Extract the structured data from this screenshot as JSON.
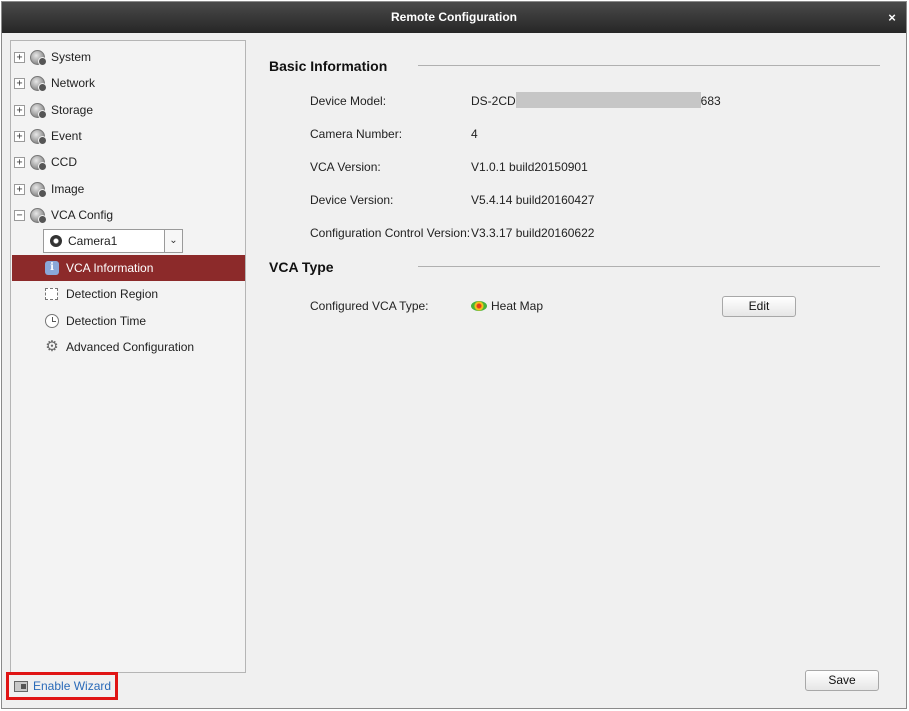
{
  "window": {
    "title": "Remote Configuration",
    "close_glyph": "×"
  },
  "sidebar": {
    "tree": [
      {
        "label": "System",
        "expander": "+"
      },
      {
        "label": "Network",
        "expander": "+"
      },
      {
        "label": "Storage",
        "expander": "+"
      },
      {
        "label": "Event",
        "expander": "+"
      },
      {
        "label": "CCD",
        "expander": "+"
      },
      {
        "label": "Image",
        "expander": "+"
      },
      {
        "label": "VCA Config",
        "expander": "−"
      }
    ],
    "camera_select": {
      "value": "Camera1",
      "chevron": "⌄"
    },
    "sub_items": [
      {
        "label": "VCA Information",
        "icon": "info-icon",
        "selected": true
      },
      {
        "label": "Detection Region",
        "icon": "region-icon",
        "selected": false
      },
      {
        "label": "Detection Time",
        "icon": "clock-icon",
        "selected": false
      },
      {
        "label": "Advanced Configuration",
        "icon": "gear-icon",
        "selected": false
      }
    ],
    "info_glyph": "i",
    "gear_glyph": "⚙"
  },
  "basic_info": {
    "title": "Basic Information",
    "fields": [
      {
        "label": "Device Model:",
        "value_prefix": "DS-2CD",
        "value_suffix": "683"
      },
      {
        "label": "Camera Number:",
        "value": "4"
      },
      {
        "label": "VCA Version:",
        "value": "V1.0.1 build20150901"
      },
      {
        "label": "Device Version:",
        "value": "V5.4.14 build20160427"
      },
      {
        "label": "Configuration Control Version:",
        "value": "V3.3.17 build20160622"
      }
    ]
  },
  "vca_type": {
    "title": "VCA Type",
    "label": "Configured VCA Type:",
    "value": "Heat Map",
    "edit_label": "Edit"
  },
  "footer": {
    "save_label": "Save",
    "wizard_label": "Enable Wizard"
  },
  "colors": {
    "selected_bg": "#8c2a2a",
    "highlight_border": "#e01414",
    "link": "#2a6ab8"
  }
}
